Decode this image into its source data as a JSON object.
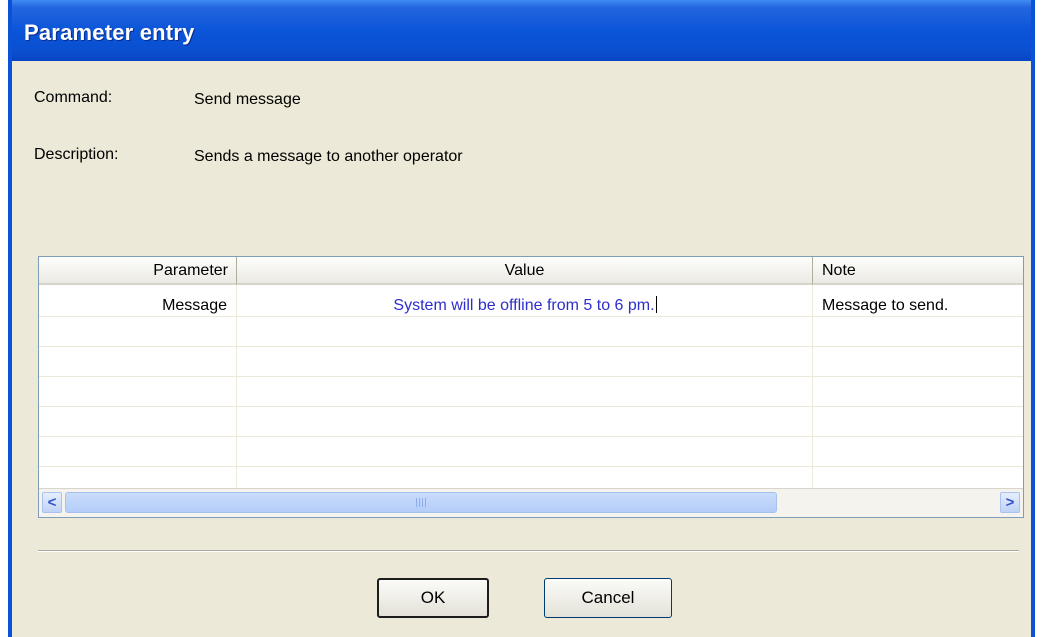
{
  "dialog": {
    "title": "Parameter entry",
    "command_label": "Command:",
    "command_value": "Send message",
    "description_label": "Description:",
    "description_value": "Sends a message to another operator"
  },
  "grid": {
    "columns": [
      "Parameter",
      "Value",
      "Note"
    ],
    "rows": [
      {
        "parameter": "Message",
        "value": "System will be offline from 5 to 6 pm.",
        "note": "Message to send."
      }
    ],
    "value_color": "#2d2dcc"
  },
  "scrollbar": {
    "left_icon": "scroll-left-arrow-icon",
    "right_icon": "scroll-right-arrow-icon",
    "left_glyph": "<",
    "right_glyph": ">"
  },
  "buttons": {
    "ok": "OK",
    "cancel": "Cancel"
  }
}
